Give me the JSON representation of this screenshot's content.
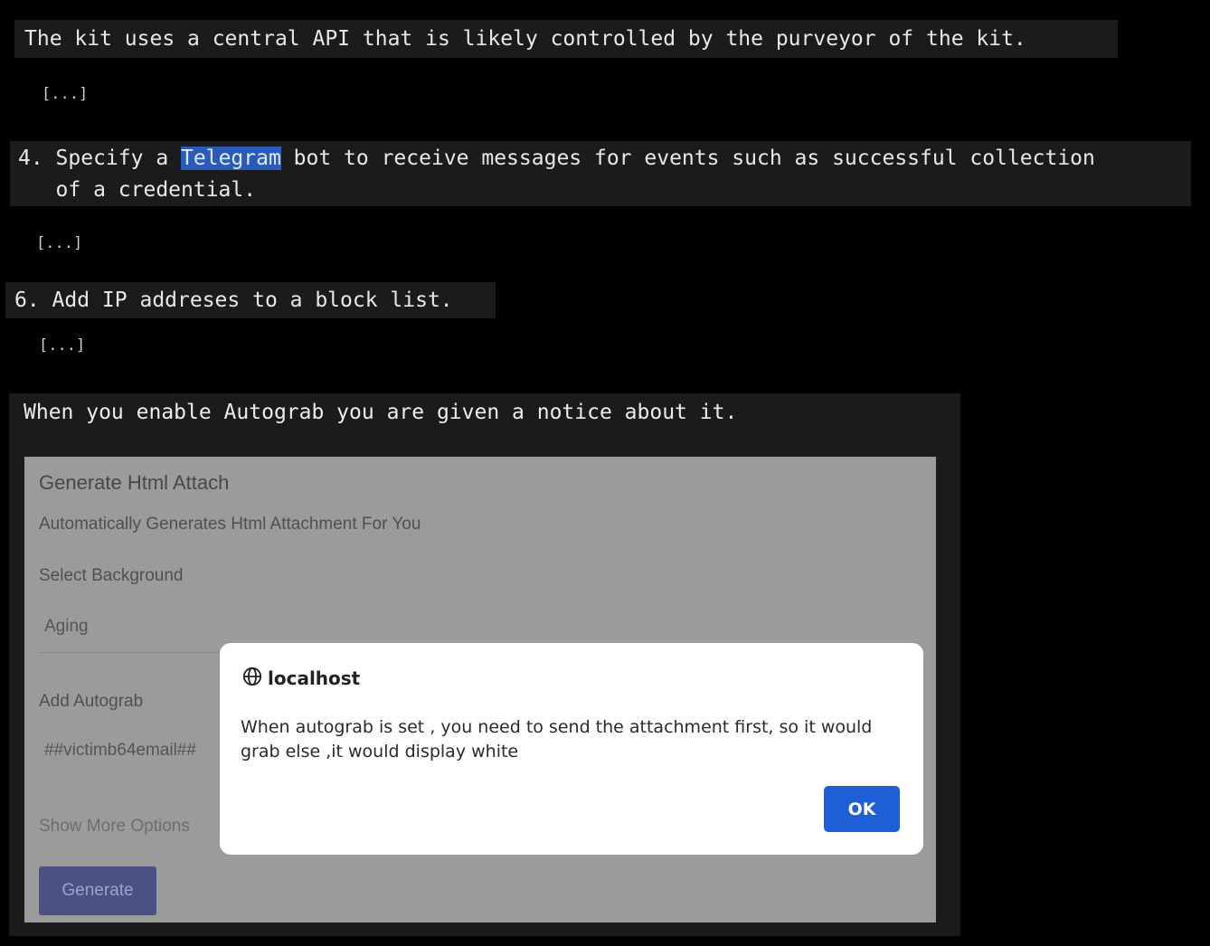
{
  "article": {
    "paragraph_1": "The kit uses a central API that is likely controlled by the purveyor of the kit.",
    "ellipsis": "[...]",
    "item_4": {
      "number": "4. ",
      "before": "Specify a ",
      "highlight": "Telegram",
      "after": " bot to receive messages for events such as successful collection",
      "line2": "   of a credential."
    },
    "item_6": "6. Add IP addreses to a block list.",
    "caption": "When you enable Autograb you are given a notice about it."
  },
  "page": {
    "title": "Generate Html Attach",
    "subtitle": "Automatically Generates Html Attachment For You",
    "background_label": "Select Background",
    "background_value": "Aging",
    "autograb_label": "Add Autograb",
    "autograb_value": "##victimb64email##",
    "show_more": "Show More Options",
    "generate_button": "Generate"
  },
  "dialog": {
    "origin_icon": "globe-icon",
    "origin": "localhost",
    "message": "When autograb is set , you need to send the attachment first, so it would grab else ,it would display white",
    "ok_button": "OK"
  },
  "colors": {
    "highlight": "#2a5bb8",
    "ok_button": "#1f5fd6",
    "generate_button": "#4b5184"
  }
}
